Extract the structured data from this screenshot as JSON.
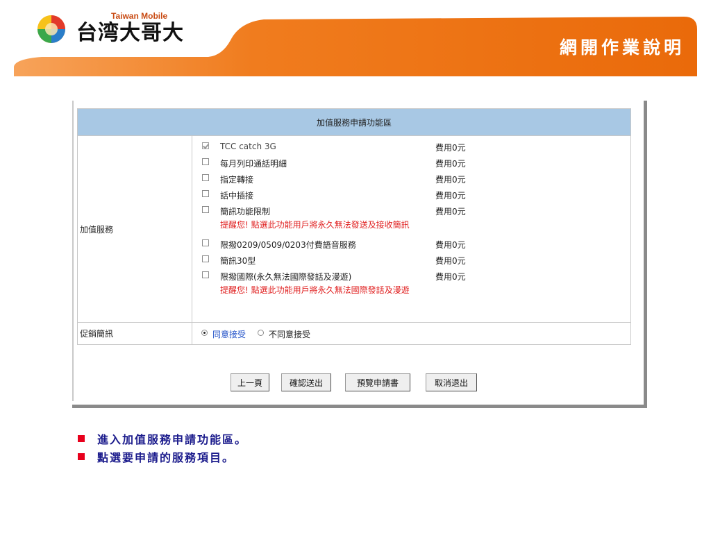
{
  "header": {
    "logo_en": "Taiwan Mobile",
    "logo_cn": "台湾大哥大",
    "page_title": "網開作業說明",
    "brand_orange": "#f07c1e"
  },
  "form": {
    "section_title": "加值服務申請功能區",
    "vas_label": "加值服務",
    "options": [
      {
        "label": "TCC catch 3G",
        "fee": "費用0元",
        "checked": true
      },
      {
        "label": "每月列印通話明細",
        "fee": "費用0元",
        "checked": false
      },
      {
        "label": "指定轉接",
        "fee": "費用0元",
        "checked": false
      },
      {
        "label": "話中插接",
        "fee": "費用0元",
        "checked": false
      },
      {
        "label": "簡訊功能限制",
        "fee": "費用0元",
        "checked": false
      },
      {
        "label": "限撥0209/0509/0203付費語音服務",
        "fee": "費用0元",
        "checked": false
      },
      {
        "label": "簡訊30型",
        "fee": "費用0元",
        "checked": false
      },
      {
        "label": "限撥國際(永久無法國際發話及漫遊)",
        "fee": "費用0元",
        "checked": false
      }
    ],
    "warnings": {
      "sms": "提醒您! 點選此功能用戶將永久無法發送及接收簡訊",
      "intl": "提醒您! 點選此功能用戶將永久無法國際發話及漫遊"
    },
    "promo_label": "促銷簡訊",
    "promo_accept": "同意接受",
    "promo_decline": "不同意接受",
    "promo_selected": "同意接受"
  },
  "buttons": {
    "prev": "上一頁",
    "confirm": "確認送出",
    "preview": "預覽申請書",
    "cancel": "取消退出"
  },
  "notes": [
    "進入加值服務申請功能區。",
    "點選要申請的服務項目。"
  ],
  "colors": {
    "header_row": "#a8c8e4",
    "warning_text": "#e02020",
    "note_text": "#1b1b8c",
    "bullet": "#e8001c"
  }
}
